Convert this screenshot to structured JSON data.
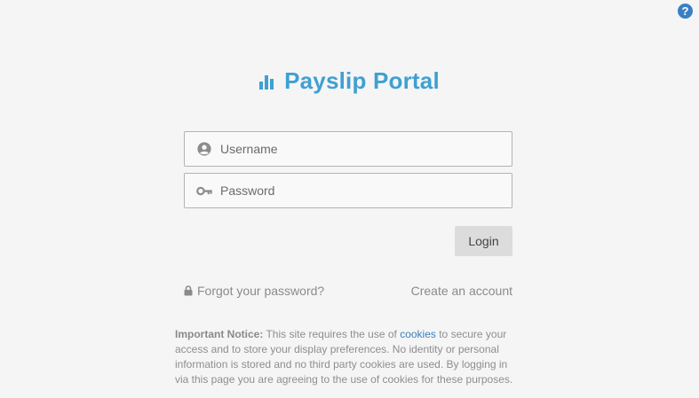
{
  "help": {
    "label": "?"
  },
  "brand": {
    "title": "Payslip Portal"
  },
  "form": {
    "username_placeholder": "Username",
    "username_value": "",
    "password_placeholder": "Password",
    "password_value": "",
    "login_label": "Login"
  },
  "links": {
    "forgot_password": "Forgot your password?",
    "create_account": "Create an account"
  },
  "notice": {
    "heading": "Important Notice:",
    "text_before": " This site requires the use of ",
    "cookies_link": "cookies",
    "text_after": " to secure your access and to store your display preferences. No identity or personal information is stored and no third party cookies are used. By logging in via this page you are agreeing to the use of cookies for these purposes."
  },
  "icons": {
    "help": "question-circle-icon",
    "brand": "bar-chart-icon",
    "username": "user-circle-icon",
    "password": "key-icon",
    "forgot": "lock-icon"
  },
  "colors": {
    "background": "#f5f5f5",
    "brand": "#3fa0d2",
    "link": "#3a7fc3",
    "muted_text": "#8a8a8a",
    "button_bg": "#dcdcdc"
  }
}
